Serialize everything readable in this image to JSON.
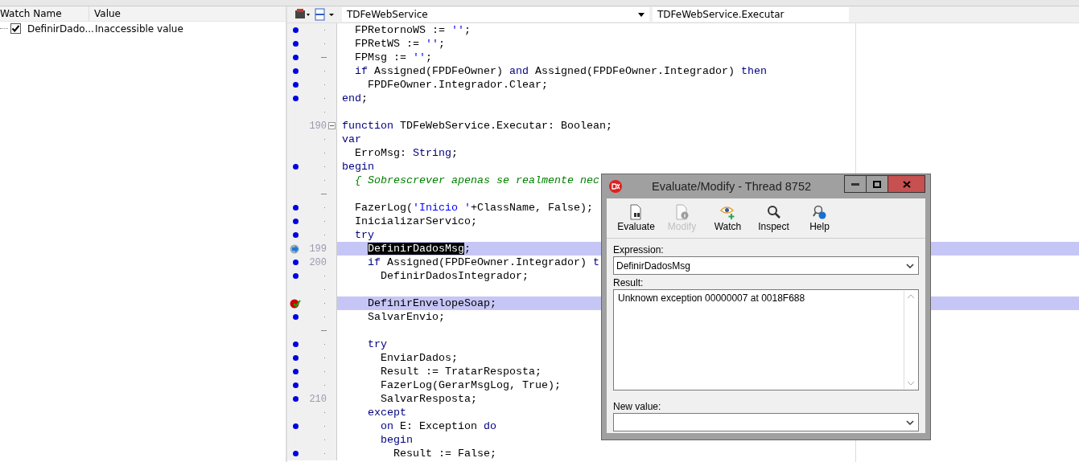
{
  "watch_list": {
    "columns": [
      "Watch Name",
      "Value"
    ],
    "rows": [
      {
        "name": "DefinirDado...",
        "value": "Inaccessible value",
        "checked": true
      }
    ]
  },
  "editor": {
    "class_selector": "TDFeWebService",
    "method_selector": "TDFeWebService.Executar",
    "lines": [
      {
        "line_dot": true,
        "fold_end": false,
        "highlighted": false,
        "segments": [
          {
            "kind": "plain",
            "text": "  FPRetornoWS := "
          },
          {
            "kind": "string",
            "text": "''"
          },
          {
            "kind": "plain",
            "text": ";"
          }
        ]
      },
      {
        "line_dot": true,
        "fold_end": false,
        "highlighted": false,
        "segments": [
          {
            "kind": "plain",
            "text": "  FPRetWS := "
          },
          {
            "kind": "string",
            "text": "''"
          },
          {
            "kind": "plain",
            "text": ";"
          }
        ]
      },
      {
        "line_dot": true,
        "fold_end": true,
        "highlighted": false,
        "segments": [
          {
            "kind": "plain",
            "text": "  FPMsg := "
          },
          {
            "kind": "string",
            "text": "''"
          },
          {
            "kind": "plain",
            "text": ";"
          }
        ]
      },
      {
        "line_dot": true,
        "fold_end": false,
        "highlighted": false,
        "segments": [
          {
            "kind": "keyword",
            "text": "  if"
          },
          {
            "kind": "plain",
            "text": " Assigned(FPDFeOwner) "
          },
          {
            "kind": "keyword",
            "text": "and"
          },
          {
            "kind": "plain",
            "text": " Assigned(FPDFeOwner.Integrador) "
          },
          {
            "kind": "keyword",
            "text": "then"
          }
        ]
      },
      {
        "line_dot": true,
        "fold_end": false,
        "highlighted": false,
        "segments": [
          {
            "kind": "plain",
            "text": "    FPDFeOwner.Integrador.Clear;"
          }
        ]
      },
      {
        "line_dot": true,
        "fold_end": false,
        "highlighted": false,
        "segments": [
          {
            "kind": "keyword",
            "text": "end"
          },
          {
            "kind": "plain",
            "text": ";"
          }
        ]
      },
      {
        "line_dot": false,
        "fold_end": false,
        "highlighted": false
      },
      {
        "number": "190",
        "line_dot": false,
        "collapsible": true,
        "highlighted": false,
        "segments": [
          {
            "kind": "keyword",
            "text": "function"
          },
          {
            "kind": "plain",
            "text": " TDFeWebService.Executar: Boolean;"
          }
        ]
      },
      {
        "line_dot": false,
        "fold_end": false,
        "highlighted": false,
        "segments": [
          {
            "kind": "keyword",
            "text": "var"
          }
        ]
      },
      {
        "line_dot": false,
        "fold_end": false,
        "highlighted": false,
        "segments": [
          {
            "kind": "plain",
            "text": "  ErroMsg: "
          },
          {
            "kind": "keyword",
            "text": "String"
          },
          {
            "kind": "plain",
            "text": ";"
          }
        ]
      },
      {
        "line_dot": true,
        "fold_end": false,
        "highlighted": false,
        "segments": [
          {
            "kind": "keyword",
            "text": "begin"
          }
        ]
      },
      {
        "line_dot": false,
        "fold_end": false,
        "highlighted": false,
        "segments": [
          {
            "kind": "comment",
            "text": "  { Sobrescrever apenas se realmente nec"
          }
        ]
      },
      {
        "line_dot": false,
        "fold_end": true,
        "highlighted": false
      },
      {
        "line_dot": true,
        "fold_end": false,
        "highlighted": false,
        "segments": [
          {
            "kind": "plain",
            "text": "  FazerLog("
          },
          {
            "kind": "string",
            "text": "'Inicio '"
          },
          {
            "kind": "plain",
            "text": "+ClassName, False);"
          }
        ]
      },
      {
        "line_dot": true,
        "fold_end": false,
        "highlighted": false,
        "segments": [
          {
            "kind": "plain",
            "text": "  InicializarServico;"
          }
        ]
      },
      {
        "line_dot": true,
        "fold_end": false,
        "highlighted": false,
        "segments": [
          {
            "kind": "keyword",
            "text": "  try"
          }
        ]
      },
      {
        "number": "199",
        "execution_point": true,
        "line_dot": false,
        "highlighted": true,
        "segments": [
          {
            "kind": "selected",
            "text": "DefinirDadosMsg"
          },
          {
            "kind": "plain",
            "text": ";"
          }
        ]
      },
      {
        "number": "200",
        "line_dot": true,
        "highlighted": false,
        "segments": [
          {
            "kind": "keyword",
            "text": "    if"
          },
          {
            "kind": "plain",
            "text": " Assigned(FPDFeOwner.Integrador) "
          },
          {
            "kind": "keyword",
            "text": "t"
          }
        ]
      },
      {
        "line_dot": true,
        "fold_end": false,
        "highlighted": false,
        "segments": [
          {
            "kind": "plain",
            "text": "      DefinirDadosIntegrador;"
          }
        ]
      },
      {
        "line_dot": false,
        "fold_end": false,
        "highlighted": false
      },
      {
        "breakpoint": true,
        "line_dot": false,
        "fold_end": false,
        "highlighted": true,
        "segments": [
          {
            "kind": "plain",
            "text": "    DefinirEnvelopeSoap;"
          }
        ]
      },
      {
        "line_dot": true,
        "fold_end": false,
        "highlighted": false,
        "segments": [
          {
            "kind": "plain",
            "text": "    SalvarEnvio;"
          }
        ]
      },
      {
        "line_dot": false,
        "fold_end": true,
        "highlighted": false
      },
      {
        "line_dot": true,
        "fold_end": false,
        "highlighted": false,
        "segments": [
          {
            "kind": "keyword",
            "text": "    try"
          }
        ]
      },
      {
        "line_dot": true,
        "fold_end": false,
        "highlighted": false,
        "segments": [
          {
            "kind": "plain",
            "text": "      EnviarDados;"
          }
        ]
      },
      {
        "line_dot": true,
        "fold_end": false,
        "highlighted": false,
        "segments": [
          {
            "kind": "plain",
            "text": "      Result := TratarResposta;"
          }
        ]
      },
      {
        "line_dot": true,
        "fold_end": false,
        "highlighted": false,
        "segments": [
          {
            "kind": "plain",
            "text": "      FazerLog(GerarMsgLog, True);"
          }
        ]
      },
      {
        "number": "210",
        "line_dot": true,
        "highlighted": false,
        "segments": [
          {
            "kind": "plain",
            "text": "      SalvarResposta;"
          }
        ]
      },
      {
        "line_dot": false,
        "fold_end": false,
        "highlighted": false,
        "segments": [
          {
            "kind": "keyword",
            "text": "    except"
          }
        ]
      },
      {
        "line_dot": true,
        "fold_end": false,
        "highlighted": false,
        "segments": [
          {
            "kind": "keyword",
            "text": "      on"
          },
          {
            "kind": "plain",
            "text": " E: Exception "
          },
          {
            "kind": "keyword",
            "text": "do"
          }
        ]
      },
      {
        "line_dot": false,
        "fold_end": false,
        "highlighted": false,
        "segments": [
          {
            "kind": "keyword",
            "text": "      begin"
          }
        ]
      },
      {
        "line_dot": true,
        "fold_end": false,
        "highlighted": false,
        "segments": [
          {
            "kind": "plain",
            "text": "        Result := False;"
          }
        ]
      }
    ]
  },
  "dialog": {
    "title": "Evaluate/Modify - Thread 8752",
    "toolbar": [
      {
        "label": "Evaluate",
        "kind": "evaluate",
        "disabled": false
      },
      {
        "label": "Modify",
        "kind": "modify",
        "disabled": true
      },
      {
        "label": "Watch",
        "kind": "watch",
        "disabled": false
      },
      {
        "label": "Inspect",
        "kind": "inspect",
        "disabled": false
      },
      {
        "label": "Help",
        "kind": "help",
        "disabled": false
      }
    ],
    "expression_label": "Expression:",
    "expression": "DefinirDadosMsg",
    "result_label": "Result:",
    "result": "Unknown exception 00000007 at 0018F688",
    "new_value_label": "New value:"
  }
}
